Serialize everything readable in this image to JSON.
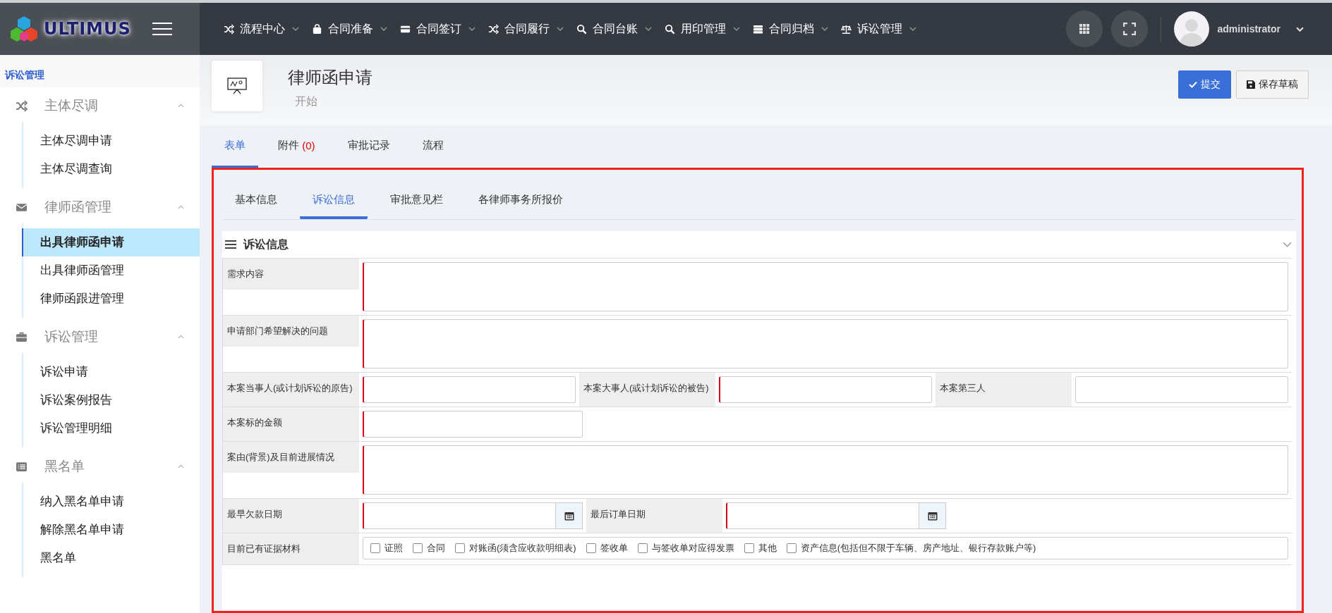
{
  "topbar": {
    "brand": "ULTIMUS",
    "nav": [
      {
        "label": "流程中心"
      },
      {
        "label": "合同准备"
      },
      {
        "label": "合同签订"
      },
      {
        "label": "合同履行"
      },
      {
        "label": "合同台账"
      },
      {
        "label": "用印管理"
      },
      {
        "label": "合同归档"
      },
      {
        "label": "诉讼管理"
      }
    ],
    "user": "administrator"
  },
  "sidebar": {
    "title": "诉讼管理",
    "groups": [
      {
        "label": "主体尽调",
        "expanded": true,
        "items": [
          {
            "label": "主体尽调申请",
            "selected": false
          },
          {
            "label": "主体尽调查询",
            "selected": false
          }
        ]
      },
      {
        "label": "律师函管理",
        "expanded": true,
        "items": [
          {
            "label": "出具律师函申请",
            "selected": true
          },
          {
            "label": "出具律师函管理",
            "selected": false
          },
          {
            "label": "律师函跟进管理",
            "selected": false
          }
        ]
      },
      {
        "label": "诉讼管理",
        "expanded": true,
        "items": [
          {
            "label": "诉讼申请",
            "selected": false
          },
          {
            "label": "诉讼案例报告",
            "selected": false
          },
          {
            "label": "诉讼管理明细",
            "selected": false
          }
        ]
      },
      {
        "label": "黑名单",
        "expanded": true,
        "items": [
          {
            "label": "纳入黑名单申请",
            "selected": false
          },
          {
            "label": "解除黑名单申请",
            "selected": false
          },
          {
            "label": "黑名单",
            "selected": false
          }
        ]
      }
    ]
  },
  "page": {
    "title": "律师函申请",
    "subtitle": "开始",
    "buttons": [
      {
        "label": "提交",
        "kind": "primary"
      },
      {
        "label": "保存草稿",
        "kind": "default"
      }
    ]
  },
  "tabs": [
    {
      "label": "表单",
      "selected": true
    },
    {
      "label": "附件",
      "count": "(0)",
      "selected": false
    },
    {
      "label": "审批记录",
      "selected": false
    },
    {
      "label": "流程",
      "selected": false
    }
  ],
  "subtabs": [
    {
      "label": "基本信息",
      "selected": false
    },
    {
      "label": "诉讼信息",
      "selected": true
    },
    {
      "label": "审批意见栏",
      "selected": false
    },
    {
      "label": "各律师事务所报价",
      "selected": false
    }
  ],
  "section": {
    "title": "诉讼信息",
    "rows": [
      {
        "kind": "textarea",
        "fields": [
          {
            "label": "需求内容",
            "required": true
          }
        ]
      },
      {
        "kind": "textarea",
        "fields": [
          {
            "label": "申请部门希望解决的问题",
            "required": true
          }
        ]
      },
      {
        "kind": "inputs",
        "fields": [
          {
            "label": "本案当事人(或计划诉讼的原告)",
            "required": true
          },
          {
            "label": "本案大事人(或计划诉讼的被告)",
            "required": true
          },
          {
            "label": "本案第三人",
            "required": false
          }
        ]
      },
      {
        "kind": "inputs",
        "fields": [
          {
            "label": "本案标的金额",
            "required": true
          }
        ]
      },
      {
        "kind": "textarea",
        "fields": [
          {
            "label": "案由(背景)及目前进展情况",
            "required": true
          }
        ]
      },
      {
        "kind": "dates",
        "fields": [
          {
            "label": "最早欠款日期",
            "required": true
          },
          {
            "label": "最后订单日期",
            "required": true
          }
        ]
      },
      {
        "kind": "checks",
        "label": "目前已有证据材料",
        "options": [
          {
            "label": "证照",
            "checked": false
          },
          {
            "label": "合同",
            "checked": false
          },
          {
            "label": "对账函(须含应收款明细表)",
            "checked": false
          },
          {
            "label": "签收单",
            "checked": false
          },
          {
            "label": "与签收单对应得发票",
            "checked": false
          },
          {
            "label": "其他",
            "checked": false
          },
          {
            "label": "资产信息(包括但不限于车辆、房产地址、银行存款账户等)",
            "checked": false
          }
        ]
      }
    ]
  }
}
